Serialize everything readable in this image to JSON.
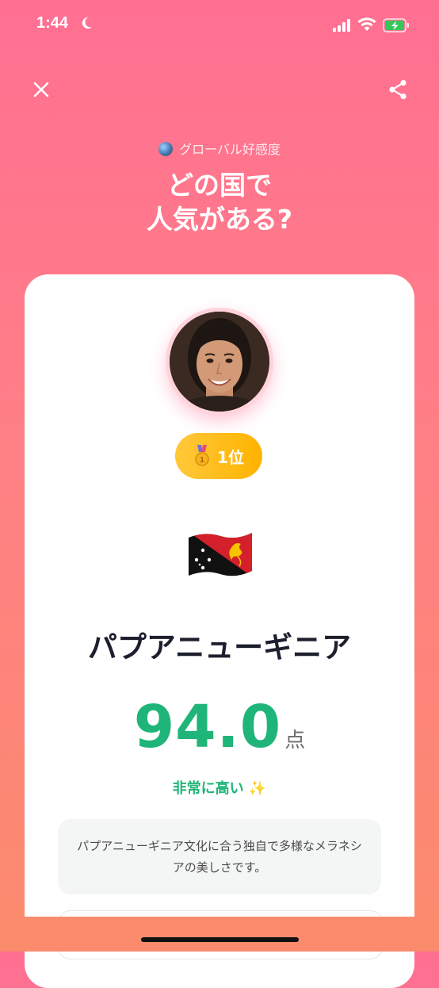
{
  "status_bar": {
    "time": "1:44"
  },
  "header": {
    "subtitle": "グローバル好感度",
    "title_line1": "どの国で",
    "title_line2": "人気がある?"
  },
  "result": {
    "rank_label": "1位",
    "country": "パプアニューギニア",
    "score": "94.0",
    "score_unit": "点",
    "rating": "非常に高い ✨",
    "description": "パプアニューギニア文化に合う独自で多様なメラネシアの美しさです。"
  },
  "colors": {
    "accent_green": "#1fb578",
    "badge_gold": "#ffb300",
    "background_top": "#ff6f92",
    "background_bottom": "#fb8b6d"
  },
  "icons": [
    "moon-icon",
    "signal-icon",
    "wifi-icon",
    "battery-charging-icon",
    "close-icon",
    "share-icon",
    "globe-icon",
    "medal-icon",
    "flag-papua-new-guinea-icon"
  ]
}
